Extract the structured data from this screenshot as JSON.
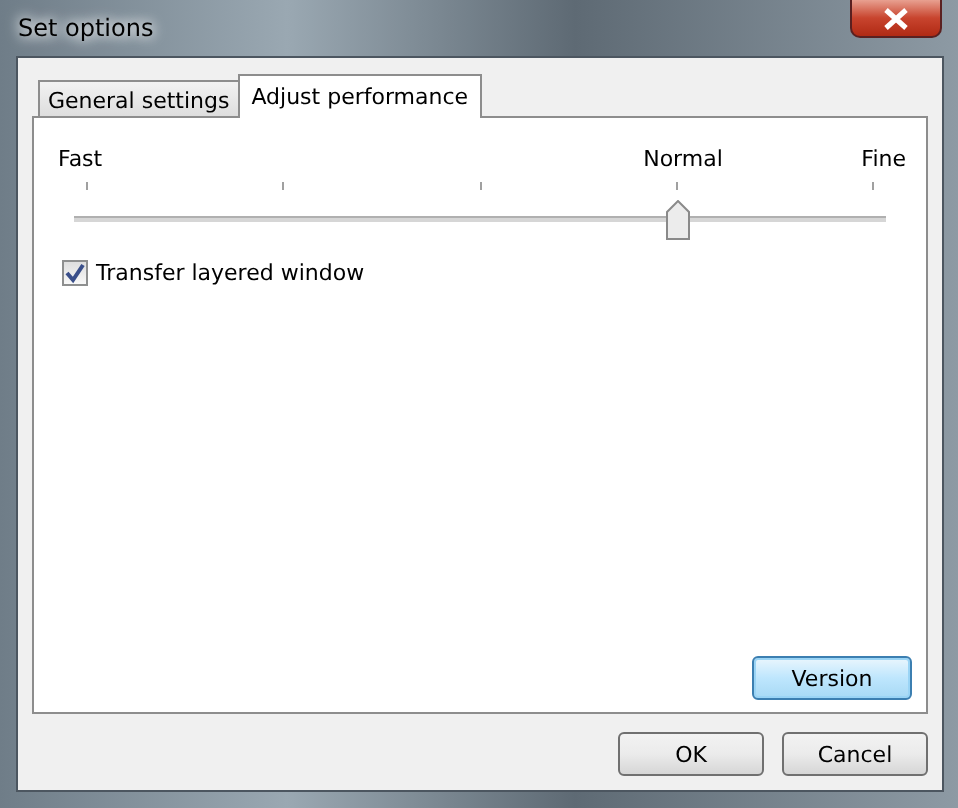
{
  "window": {
    "title": "Set options"
  },
  "tabs": [
    {
      "label": "General settings",
      "selected": false
    },
    {
      "label": "Adjust performance",
      "selected": true
    }
  ],
  "slider": {
    "labels": [
      "Fast",
      "Normal",
      "Fine"
    ],
    "level": 0.75
  },
  "checkbox": {
    "label": "Transfer layered window",
    "checked": true
  },
  "version_button": "Version",
  "buttons": [
    "OK",
    "Cancel"
  ]
}
